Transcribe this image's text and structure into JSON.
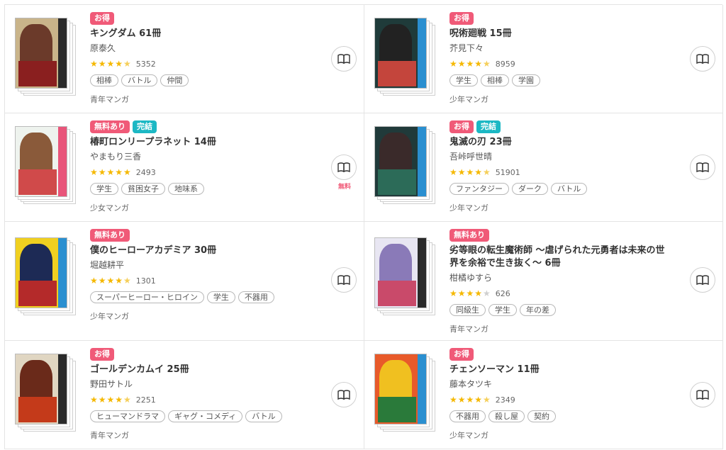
{
  "items": [
    {
      "badges": [
        {
          "label": "お得",
          "type": "deal"
        }
      ],
      "title": "キングダム 61冊",
      "author": "原泰久",
      "rating_stars": "★★★★",
      "rating_half": "★",
      "rating": 4.5,
      "rating_count": "5352",
      "tags": [
        "相棒",
        "バトル",
        "仲間"
      ],
      "genre": "青年マンガ",
      "cover_colors": {
        "bg": "#c9b48a",
        "spine": "#2a2a2a",
        "a1": "#6b3a2a",
        "a2": "#8a1f1f"
      },
      "read_icon": "book-open-icon"
    },
    {
      "badges": [
        {
          "label": "お得",
          "type": "deal"
        }
      ],
      "title": "呪術廻戦 15冊",
      "author": "芥見下々",
      "rating_stars": "★★★★",
      "rating_half": "★",
      "rating": 4.5,
      "rating_count": "8959",
      "tags": [
        "学生",
        "相棒",
        "学園"
      ],
      "genre": "少年マンガ",
      "cover_colors": {
        "bg": "#1f3b3a",
        "spine": "#2a8fd0",
        "a1": "#222",
        "a2": "#c4453c"
      },
      "read_icon": "book-open-icon"
    },
    {
      "badges": [
        {
          "label": "無料あり",
          "type": "free"
        },
        {
          "label": "完結",
          "type": "done"
        }
      ],
      "title": "椿町ロンリープラネット 14冊",
      "author": "やまもり三香",
      "rating_stars": "★★★★★",
      "rating_half": "",
      "rating": 5,
      "rating_count": "2493",
      "tags": [
        "学生",
        "貧困女子",
        "地味系"
      ],
      "genre": "少女マンガ",
      "cover_colors": {
        "bg": "#eef3ee",
        "spine": "#e8557a",
        "a1": "#8a5a3a",
        "a2": "#d04a4a"
      },
      "read_icon": "book-open-icon",
      "free_note": "無料"
    },
    {
      "badges": [
        {
          "label": "お得",
          "type": "deal"
        },
        {
          "label": "完結",
          "type": "done"
        }
      ],
      "title": "鬼滅の刃 23冊",
      "author": "吾峠呼世晴",
      "rating_stars": "★★★★",
      "rating_half": "★",
      "rating": 4.5,
      "rating_count": "51901",
      "tags": [
        "ファンタジー",
        "ダーク",
        "バトル"
      ],
      "genre": "少年マンガ",
      "cover_colors": {
        "bg": "#203a3a",
        "spine": "#2a8fd0",
        "a1": "#3a2a2a",
        "a2": "#2c6b58"
      },
      "read_icon": "book-open-icon"
    },
    {
      "badges": [
        {
          "label": "無料あり",
          "type": "free"
        }
      ],
      "title": "僕のヒーローアカデミア 30冊",
      "author": "堀越耕平",
      "rating_stars": "★★★★",
      "rating_half": "★",
      "rating": 4.5,
      "rating_count": "1301",
      "tags": [
        "スーパーヒーロー・ヒロイン",
        "学生",
        "不器用"
      ],
      "genre": "少年マンガ",
      "cover_colors": {
        "bg": "#f0d020",
        "spine": "#2a8fd0",
        "a1": "#1d2a55",
        "a2": "#b42a2a"
      },
      "read_icon": "book-open-icon"
    },
    {
      "badges": [
        {
          "label": "無料あり",
          "type": "free"
        }
      ],
      "title": "劣等眼の転生魔術師 ～虐げられた元勇者は未来の世界を余裕で生き抜く～ 6冊",
      "author": "柑橘ゆすら",
      "rating_stars": "★★★★",
      "rating_half": "",
      "rating_off": "★",
      "rating": 4,
      "rating_count": "626",
      "tags": [
        "同級生",
        "学生",
        "年の差"
      ],
      "genre": "青年マンガ",
      "cover_colors": {
        "bg": "#e8e6f2",
        "spine": "#2a2a2a",
        "a1": "#8a7ab8",
        "a2": "#c94a6a"
      },
      "read_icon": "book-open-icon"
    },
    {
      "badges": [
        {
          "label": "お得",
          "type": "deal"
        }
      ],
      "title": "ゴールデンカムイ 25冊",
      "author": "野田サトル",
      "rating_stars": "★★★★",
      "rating_half": "★",
      "rating": 4.5,
      "rating_count": "2251",
      "tags": [
        "ヒューマンドラマ",
        "ギャグ・コメディ",
        "バトル"
      ],
      "genre": "青年マンガ",
      "cover_colors": {
        "bg": "#e0d6c2",
        "spine": "#2a2a2a",
        "a1": "#6a2a1a",
        "a2": "#c43a1a"
      },
      "read_icon": "book-open-icon"
    },
    {
      "badges": [
        {
          "label": "お得",
          "type": "deal"
        }
      ],
      "title": "チェンソーマン 11冊",
      "author": "藤本タツキ",
      "rating_stars": "★★★★",
      "rating_half": "★",
      "rating": 4.5,
      "rating_count": "2349",
      "tags": [
        "不器用",
        "殺し屋",
        "契約"
      ],
      "genre": "少年マンガ",
      "cover_colors": {
        "bg": "#e85a2a",
        "spine": "#2a8fd0",
        "a1": "#f0c020",
        "a2": "#2a7a3a"
      },
      "read_icon": "book-open-icon"
    }
  ]
}
